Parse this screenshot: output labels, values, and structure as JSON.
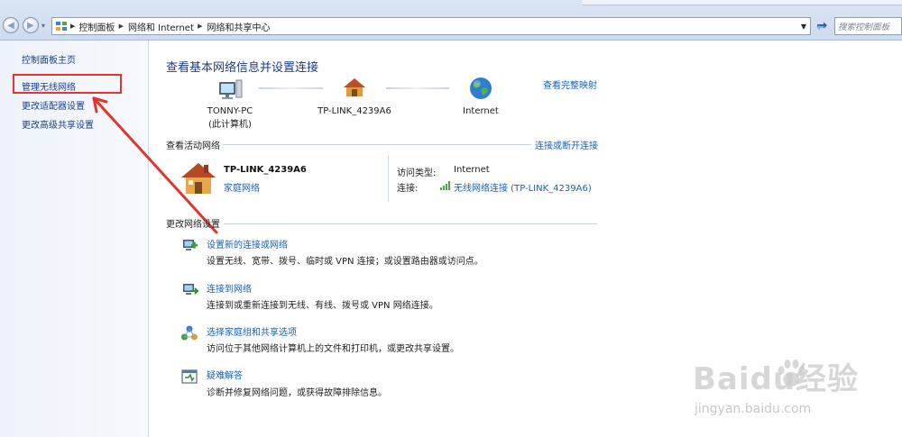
{
  "address_bar": {
    "breadcrumbs": [
      "控制面板",
      "网络和 Internet",
      "网络和共享中心"
    ],
    "search_placeholder": "搜索控制面板"
  },
  "sidebar": {
    "items": [
      {
        "label": "控制面板主页"
      },
      {
        "label": "管理无线网络",
        "highlighted": true
      },
      {
        "label": "更改适配器设置"
      },
      {
        "label": "更改高级共享设置"
      }
    ],
    "highlight_color": "#e3342e"
  },
  "main": {
    "title": "查看基本网络信息并设置连接",
    "full_map_link": "查看完整映射",
    "network_map": [
      {
        "name": "TONNY-PC",
        "sub": "(此计算机)",
        "icon": "computer-icon"
      },
      {
        "name": "TP-LINK_4239A6",
        "sub": "",
        "icon": "home-network-icon"
      },
      {
        "name": "Internet",
        "sub": "",
        "icon": "globe-icon"
      }
    ],
    "active_networks": {
      "header": "查看活动网络",
      "connect_link": "连接或断开连接",
      "network_name": "TP-LINK_4239A6",
      "network_type": "家庭网络",
      "access_type_label": "访问类型:",
      "access_type_value": "Internet",
      "connection_label": "连接:",
      "connection_value": "无线网络连接 (TP-LINK_4239A6)"
    },
    "change_settings": {
      "header": "更改网络设置",
      "tasks": [
        {
          "title": "设置新的连接或网络",
          "desc": "设置无线、宽带、拨号、临时或 VPN 连接；或设置路由器或访问点。",
          "icon": "new-connection-icon"
        },
        {
          "title": "连接到网络",
          "desc": "连接到或重新连接到无线、有线、拨号或 VPN 网络连接。",
          "icon": "connect-network-icon"
        },
        {
          "title": "选择家庭组和共享选项",
          "desc": "访问位于其他网络计算机上的文件和打印机，或更改共享设置。",
          "icon": "homegroup-icon"
        },
        {
          "title": "疑难解答",
          "desc": "诊断并修复网络问题，或获得故障排除信息。",
          "icon": "troubleshoot-icon"
        }
      ]
    }
  },
  "watermark": {
    "main": "Baidu经验",
    "sub": "jingyan.baidu.com"
  }
}
